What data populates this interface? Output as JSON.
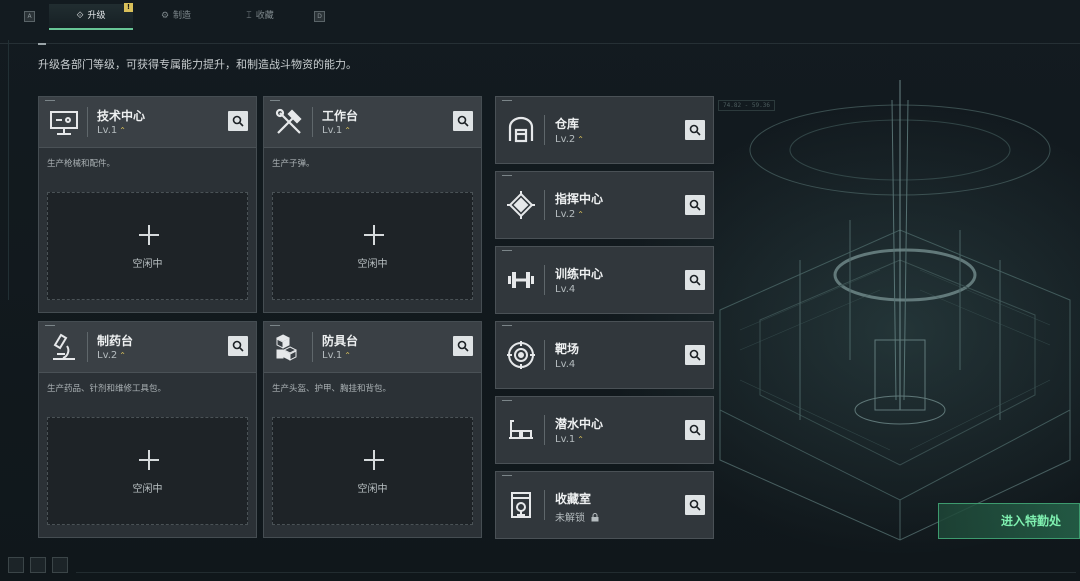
{
  "tabs": {
    "left_key": "A",
    "right_key": "D",
    "items": [
      {
        "label": "升级",
        "icon": "upgrade-icon",
        "active": true
      },
      {
        "label": "制造",
        "icon": "craft-icon",
        "active": false
      },
      {
        "label": "收藏",
        "icon": "collection-icon",
        "active": false
      }
    ],
    "alert": "!"
  },
  "description": "升级各部门等级，可获得专属能力提升，和制造战斗物资的能力。",
  "big_cards": [
    {
      "name": "技术中心",
      "level": "Lv.1",
      "desc": "生产枪械和配件。",
      "slot": "空闲中",
      "icon": "computer-icon"
    },
    {
      "name": "工作台",
      "level": "Lv.1",
      "desc": "生产子弹。",
      "slot": "空闲中",
      "icon": "tools-icon"
    },
    {
      "name": "制药台",
      "level": "Lv.2",
      "desc": "生产药品、针剂和维修工具包。",
      "slot": "空闲中",
      "icon": "microscope-icon"
    },
    {
      "name": "防具台",
      "level": "Lv.1",
      "desc": "生产头盔、护甲、胸挂和背包。",
      "slot": "空闲中",
      "icon": "armor-boxes-icon"
    }
  ],
  "small_cards": [
    {
      "name": "仓库",
      "level": "Lv.2",
      "upgradable": true,
      "icon": "warehouse-icon"
    },
    {
      "name": "指挥中心",
      "level": "Lv.2",
      "upgradable": true,
      "icon": "chip-icon"
    },
    {
      "name": "训练中心",
      "level": "Lv.4",
      "upgradable": false,
      "icon": "dumbbell-icon"
    },
    {
      "name": "靶场",
      "level": "Lv.4",
      "upgradable": false,
      "icon": "target-icon"
    },
    {
      "name": "潜水中心",
      "level": "Lv.1",
      "upgradable": true,
      "icon": "diving-mask-icon"
    },
    {
      "name": "收藏室",
      "level": "未解锁",
      "upgradable": false,
      "locked": true,
      "icon": "trophy-cabinet-icon"
    }
  ],
  "coord_text": "74.82 - 59.36",
  "enter_button": "进入特勤处",
  "colors": {
    "accent": "#68c596",
    "upgrade": "#d9c05a",
    "enter": "#7ff0b0"
  }
}
